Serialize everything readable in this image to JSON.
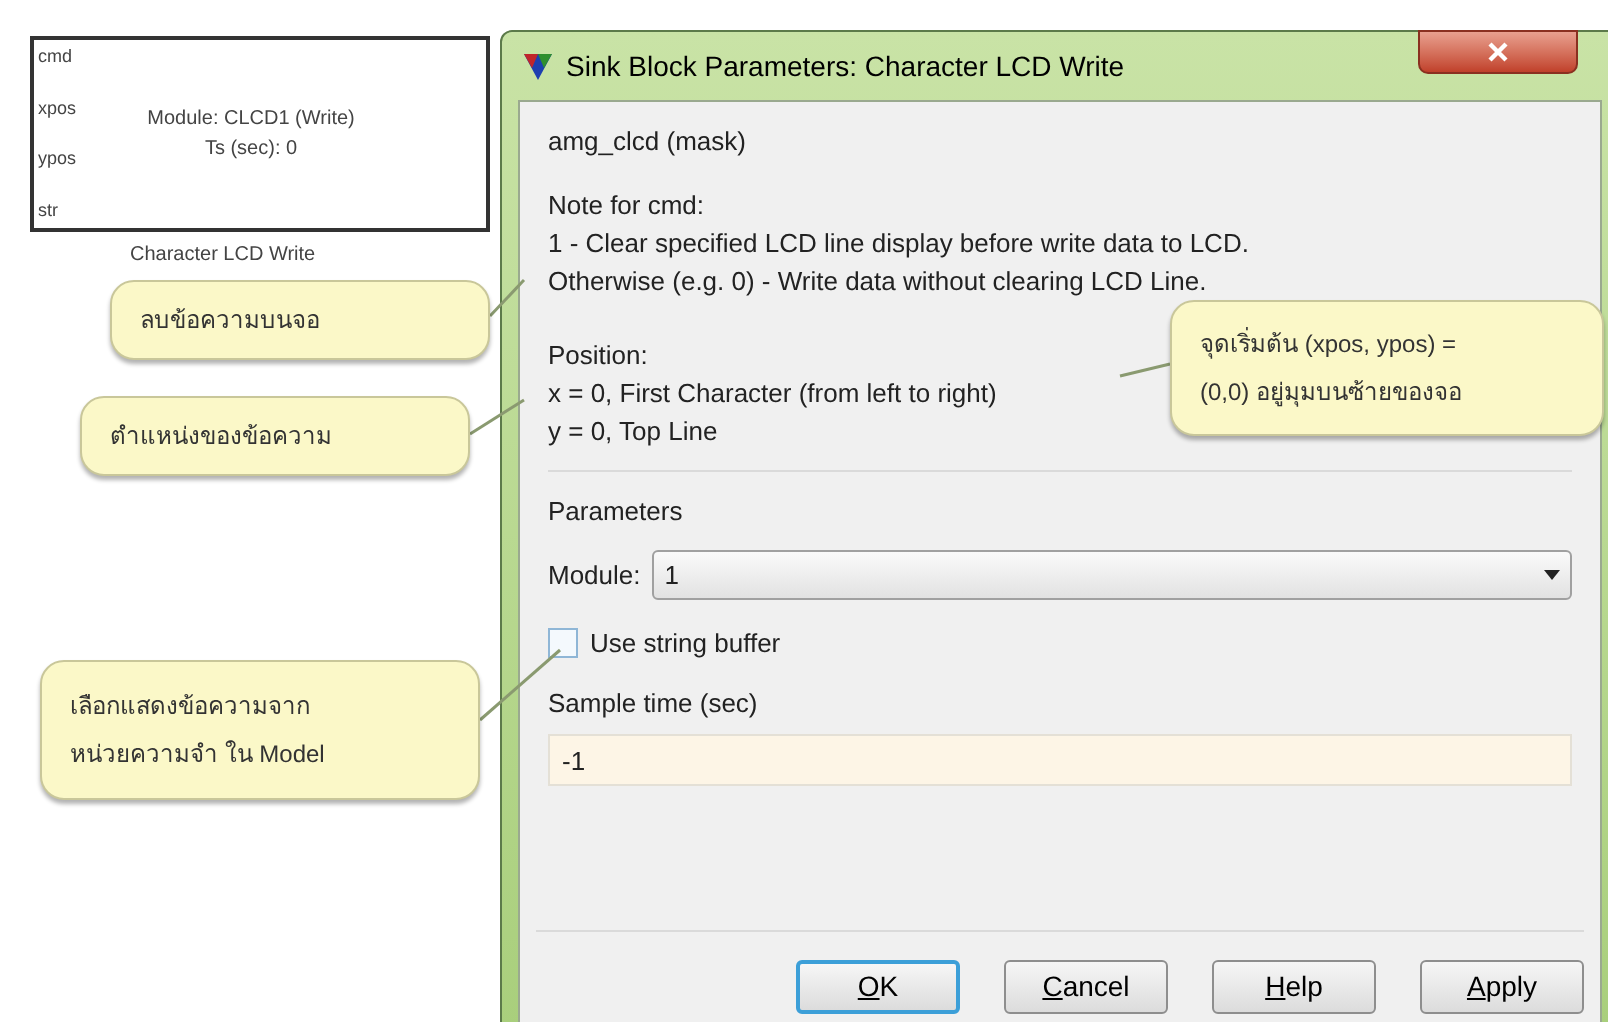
{
  "block": {
    "ports": [
      "cmd",
      "xpos",
      "ypos",
      "str"
    ],
    "lines": [
      "Module: CLCD1 (Write)",
      "Ts (sec): 0"
    ],
    "caption": "Character LCD Write"
  },
  "dialog": {
    "title": "Sink Block Parameters: Character LCD Write",
    "mask": "amg_clcd (mask)",
    "description": [
      "Note for cmd:",
      "1 - Clear specified LCD line display before write data to LCD.",
      "Otherwise (e.g. 0) - Write data without clearing LCD Line."
    ],
    "position": [
      "Position:",
      "x = 0, First Character (from left to right)",
      "y = 0, Top Line"
    ],
    "parameters_title": "Parameters",
    "module": {
      "label": "Module:",
      "value": "1"
    },
    "string_buffer": {
      "label": "Use string buffer",
      "checked": false
    },
    "sample_time": {
      "label": "Sample time (sec)",
      "value": "-1"
    },
    "buttons": [
      {
        "label": "OK",
        "default": true,
        "underline_first": true
      },
      {
        "label": "Cancel",
        "default": false,
        "underline_first": true
      },
      {
        "label": "Help",
        "default": false,
        "underline_first": true
      },
      {
        "label": "Apply",
        "default": false,
        "underline_first": true
      }
    ]
  },
  "callouts": [
    {
      "lines": [
        "ลบข้อความบนจอ"
      ]
    },
    {
      "lines": [
        "จุดเริ่มต้น (xpos, ypos) =",
        "(0,0) อยู่มุมบนซ้ายของจอ"
      ]
    },
    {
      "lines": [
        "ตำแหน่งของข้อความ"
      ]
    },
    {
      "lines": [
        "เลือกแสดงข้อความจาก",
        "หน่วยความจำ ใน Model"
      ]
    }
  ]
}
